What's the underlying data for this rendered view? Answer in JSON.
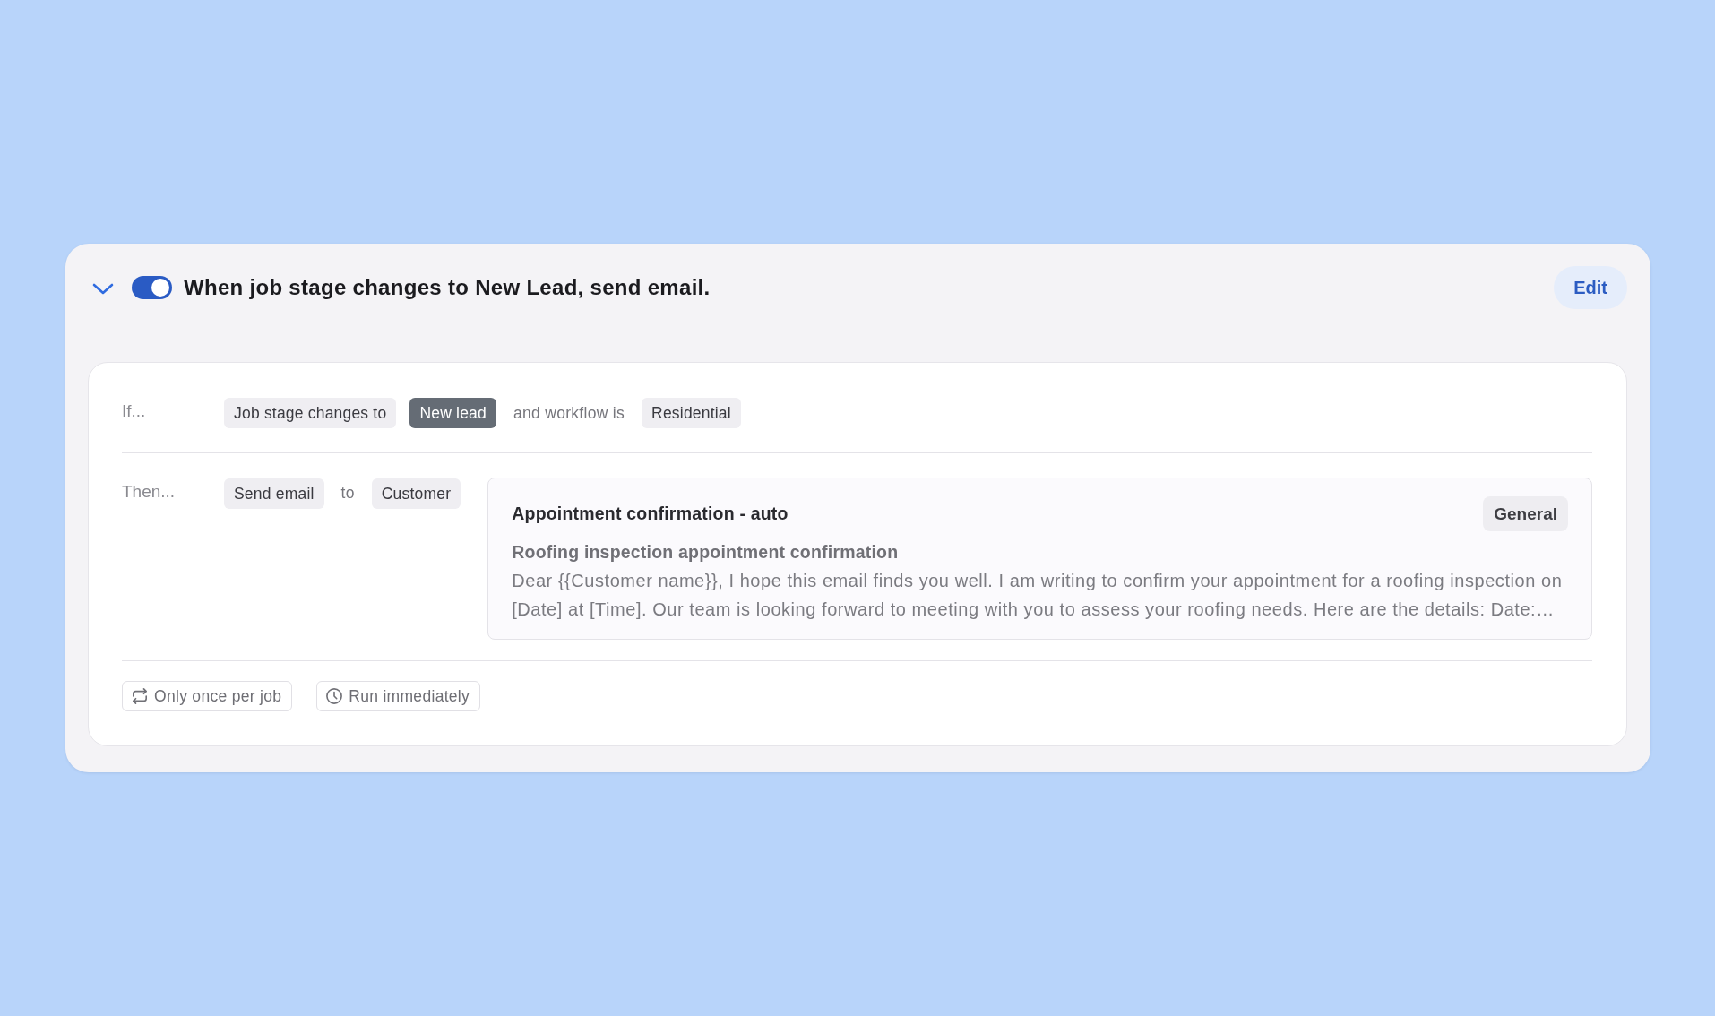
{
  "rule": {
    "expanded": true,
    "enabled": true,
    "title": "When job stage changes to New Lead, send email.",
    "edit_button": "Edit"
  },
  "condition": {
    "label": "If...",
    "parts": [
      {
        "kind": "tag",
        "text": "Job stage changes to"
      },
      {
        "kind": "highlight",
        "text": "New lead"
      },
      {
        "kind": "text",
        "text": "and workflow is"
      },
      {
        "kind": "tag",
        "text": "Residential"
      }
    ]
  },
  "action": {
    "label": "Then...",
    "parts": [
      {
        "kind": "tag",
        "text": "Send email"
      },
      {
        "kind": "text",
        "text": "to"
      },
      {
        "kind": "tag",
        "text": "Customer"
      }
    ],
    "email_template": {
      "name": "Appointment confirmation - auto",
      "category": "General",
      "subject": "Roofing inspection appointment confirmation",
      "body": "Dear {{Customer name}}, I hope this email finds you well. I am writing to confirm your appointment for a roofing inspection on [Date] at [Time]. Our team is looking forward to meeting with you to assess your roofing needs. Here are the details: Date:…"
    }
  },
  "options": [
    {
      "kind": "frequency",
      "text": "Only once per job"
    },
    {
      "kind": "timing",
      "text": "Run immediately"
    }
  ]
}
